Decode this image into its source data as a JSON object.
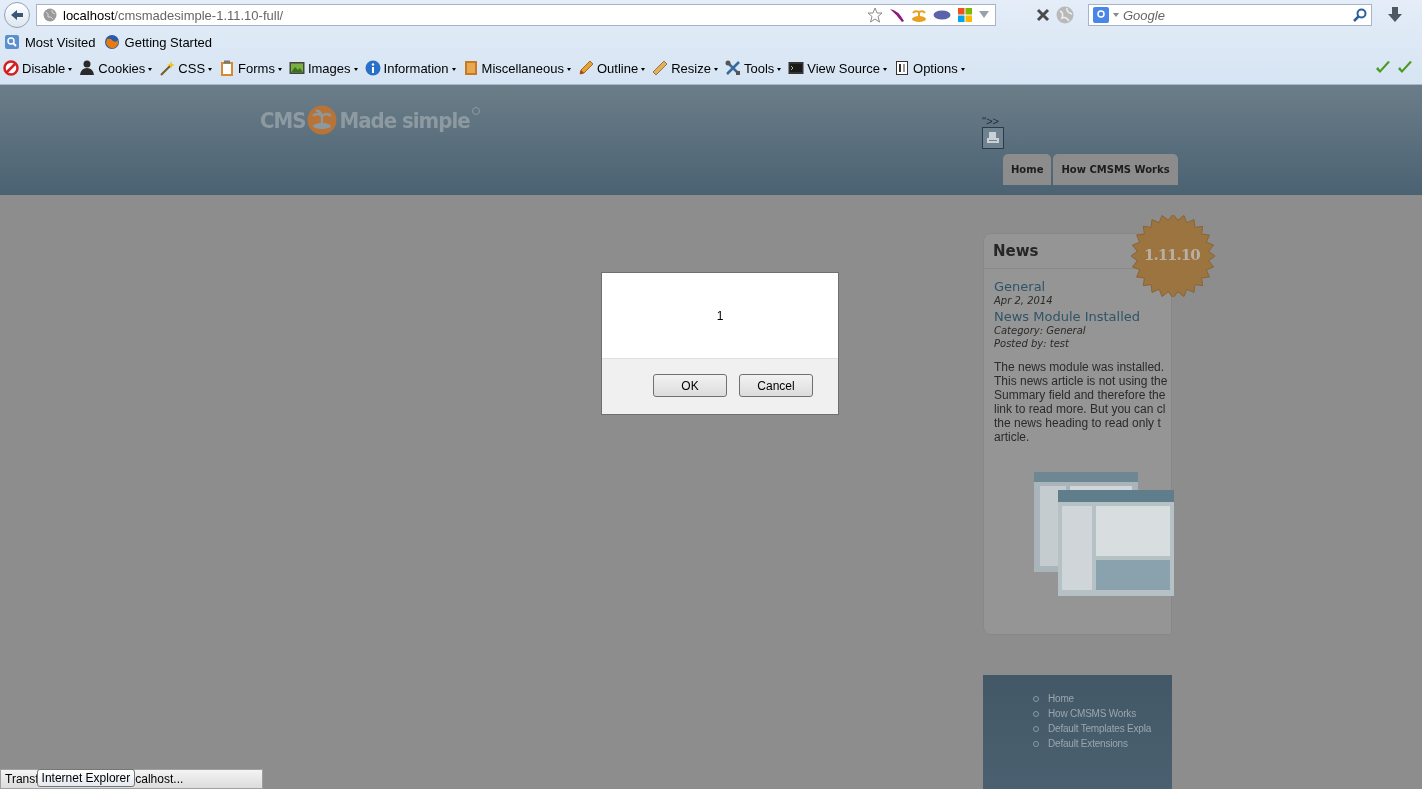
{
  "browser": {
    "url_host": "localhost",
    "url_path": "/cmsmadesimple-1.11.10-full/",
    "search_placeholder": "Google",
    "bookmarks": [
      {
        "label": "Most Visited"
      },
      {
        "label": "Getting Started"
      }
    ],
    "dev_toolbar": [
      {
        "label": "Disable"
      },
      {
        "label": "Cookies"
      },
      {
        "label": "CSS"
      },
      {
        "label": "Forms"
      },
      {
        "label": "Images"
      },
      {
        "label": "Information"
      },
      {
        "label": "Miscellaneous"
      },
      {
        "label": "Outline"
      },
      {
        "label": "Resize"
      },
      {
        "label": "Tools"
      },
      {
        "label": "View Source"
      },
      {
        "label": "Options"
      }
    ]
  },
  "page": {
    "logo": [
      "CMS",
      "Made simple"
    ],
    "header_mark": "''>>",
    "tabs": [
      {
        "label": "Home",
        "selected": false
      },
      {
        "label": "How CMSMS Works",
        "selected": false
      }
    ],
    "news": {
      "title": "News",
      "badge": "1.11.10",
      "category": "General",
      "date": "Apr 2, 2014",
      "article_title": "News Module Installed",
      "meta": [
        "Category: General",
        "Posted by: test"
      ],
      "body": [
        "The news module was installed.",
        "This news article is not using the",
        "Summary field and therefore the",
        "link to read more. But you can cl",
        "the news heading to read only t",
        "article."
      ]
    },
    "nav_menu": [
      {
        "label": "Home"
      },
      {
        "label": "How CMSMS Works"
      },
      {
        "label": "Default Templates Expla"
      },
      {
        "label": "Default Extensions"
      }
    ]
  },
  "dialog": {
    "message": "1",
    "buttons": [
      "OK",
      "Cancel"
    ]
  },
  "status_bar": {
    "parts": [
      "Transf",
      "calhost..."
    ],
    "tooltip": "Internet Explorer"
  }
}
